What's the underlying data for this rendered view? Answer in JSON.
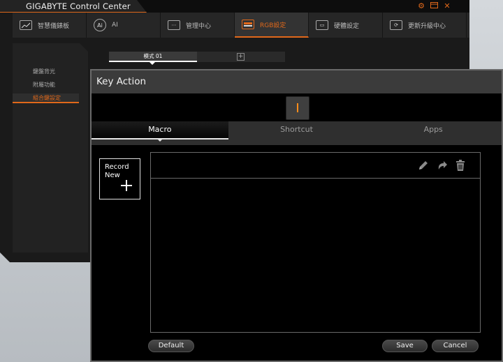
{
  "app": {
    "title": "GIGABYTE Control Center",
    "window_controls": [
      "gear-icon",
      "restore-icon",
      "close-icon"
    ],
    "accent_color": "#e0681a"
  },
  "topnav": {
    "tabs": [
      {
        "label": "智慧儀錶板",
        "icon": "dashboard-icon",
        "active": false
      },
      {
        "label": "AI",
        "icon": "ai-icon",
        "active": false
      },
      {
        "label": "管理中心",
        "icon": "keyboard-icon",
        "active": false
      },
      {
        "label": "RGB設定",
        "icon": "rgb-keyboard-icon",
        "active": true
      },
      {
        "label": "硬體設定",
        "icon": "laptop-icon",
        "active": false
      },
      {
        "label": "更新升級中心",
        "icon": "update-icon",
        "active": false
      }
    ]
  },
  "sidebar": {
    "items": [
      {
        "label": "鍵盤背光",
        "active": false
      },
      {
        "label": "附屬功能",
        "active": false
      },
      {
        "label": "組合鍵設定",
        "active": true
      }
    ]
  },
  "profiles": {
    "active_label": "模式 01",
    "add_icon": "plus-box-icon"
  },
  "dialog": {
    "title": "Key Action",
    "key_label": "I",
    "key_color": "#ff8c1a",
    "tabs": [
      {
        "label": "Macro",
        "active": true
      },
      {
        "label": "Shortcut",
        "active": false
      },
      {
        "label": "Apps",
        "active": false
      }
    ],
    "record_new": {
      "line1": "Record",
      "line2": "New",
      "icon": "plus-icon"
    },
    "toolbar_icons": [
      "pencil-icon",
      "redo-icon",
      "trash-icon"
    ],
    "buttons": {
      "default": "Default",
      "save": "Save",
      "cancel": "Cancel"
    }
  }
}
